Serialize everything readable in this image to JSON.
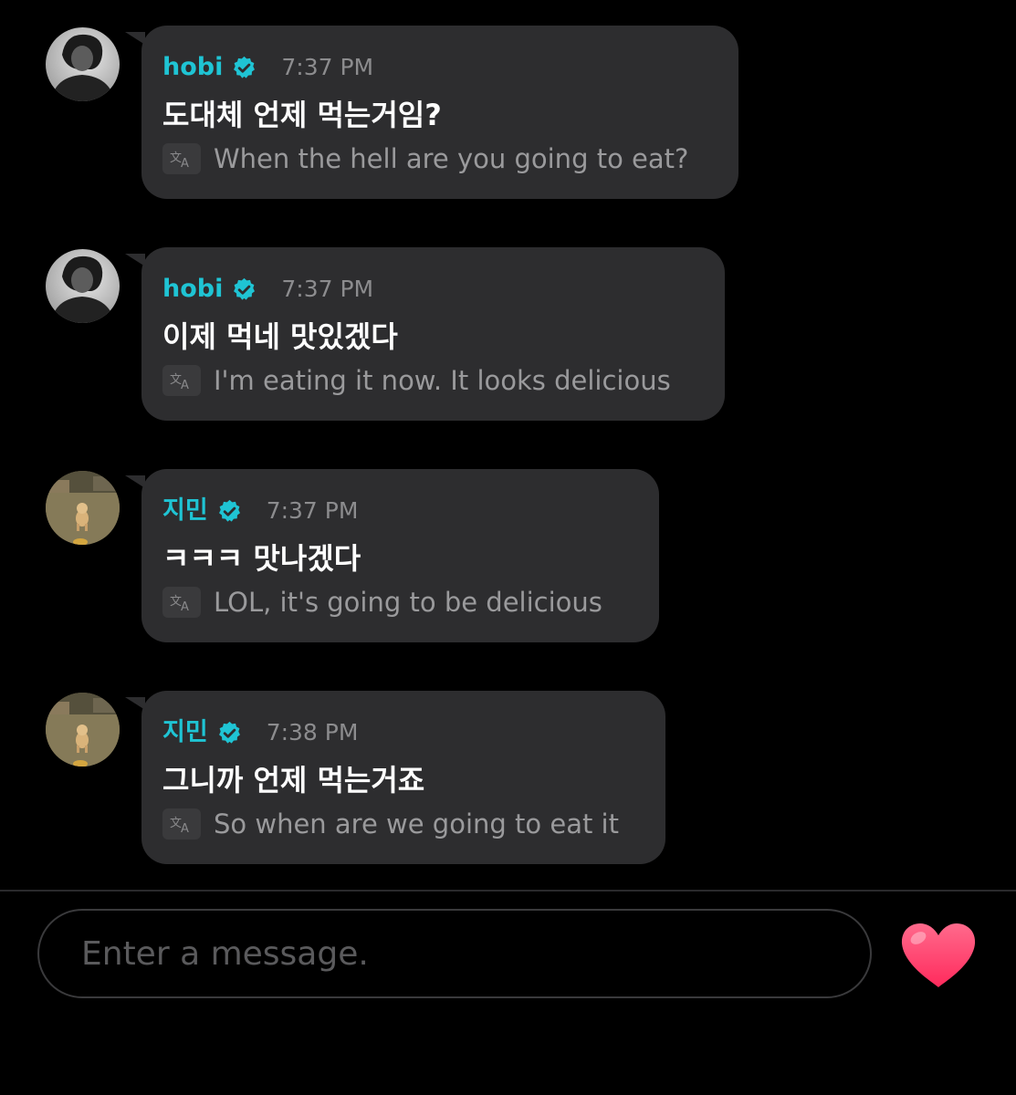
{
  "messages": [
    {
      "sender": "hobi",
      "time": "7:37 PM",
      "text": "도대체 언제 먹는거임?",
      "translation": "When the hell are you going to eat?",
      "avatar": "hobi-avatar",
      "verified": true
    },
    {
      "sender": "hobi",
      "time": "7:37 PM",
      "text": "이제 먹네 맛있겠다",
      "translation": "I'm eating it now. It looks delicious",
      "avatar": "hobi-avatar",
      "verified": true
    },
    {
      "sender": "지민",
      "time": "7:37 PM",
      "text": "ㅋㅋㅋ 맛나겠다",
      "translation": "LOL, it's going to be delicious",
      "avatar": "jimin-avatar",
      "verified": true
    },
    {
      "sender": "지민",
      "time": "7:38 PM",
      "text": "그니까 언제 먹는거죠",
      "translation": "So when are we going to eat it",
      "avatar": "jimin-avatar",
      "verified": true
    }
  ],
  "composer": {
    "placeholder": "Enter a message.",
    "value": "",
    "send_icon": "heart-icon"
  },
  "colors": {
    "background": "#000000",
    "bubble": "#2d2d2f",
    "sender_name": "#1fc4d4",
    "verified_badge": "#1fc4d4",
    "message_text": "#ffffff",
    "translation_text": "#9a9a9c",
    "time_text": "#8c8c8e",
    "heart": "#ff3f6e"
  },
  "icons": {
    "verified": "verified-badge-icon",
    "translate": "translate-icon",
    "send": "heart-icon"
  }
}
